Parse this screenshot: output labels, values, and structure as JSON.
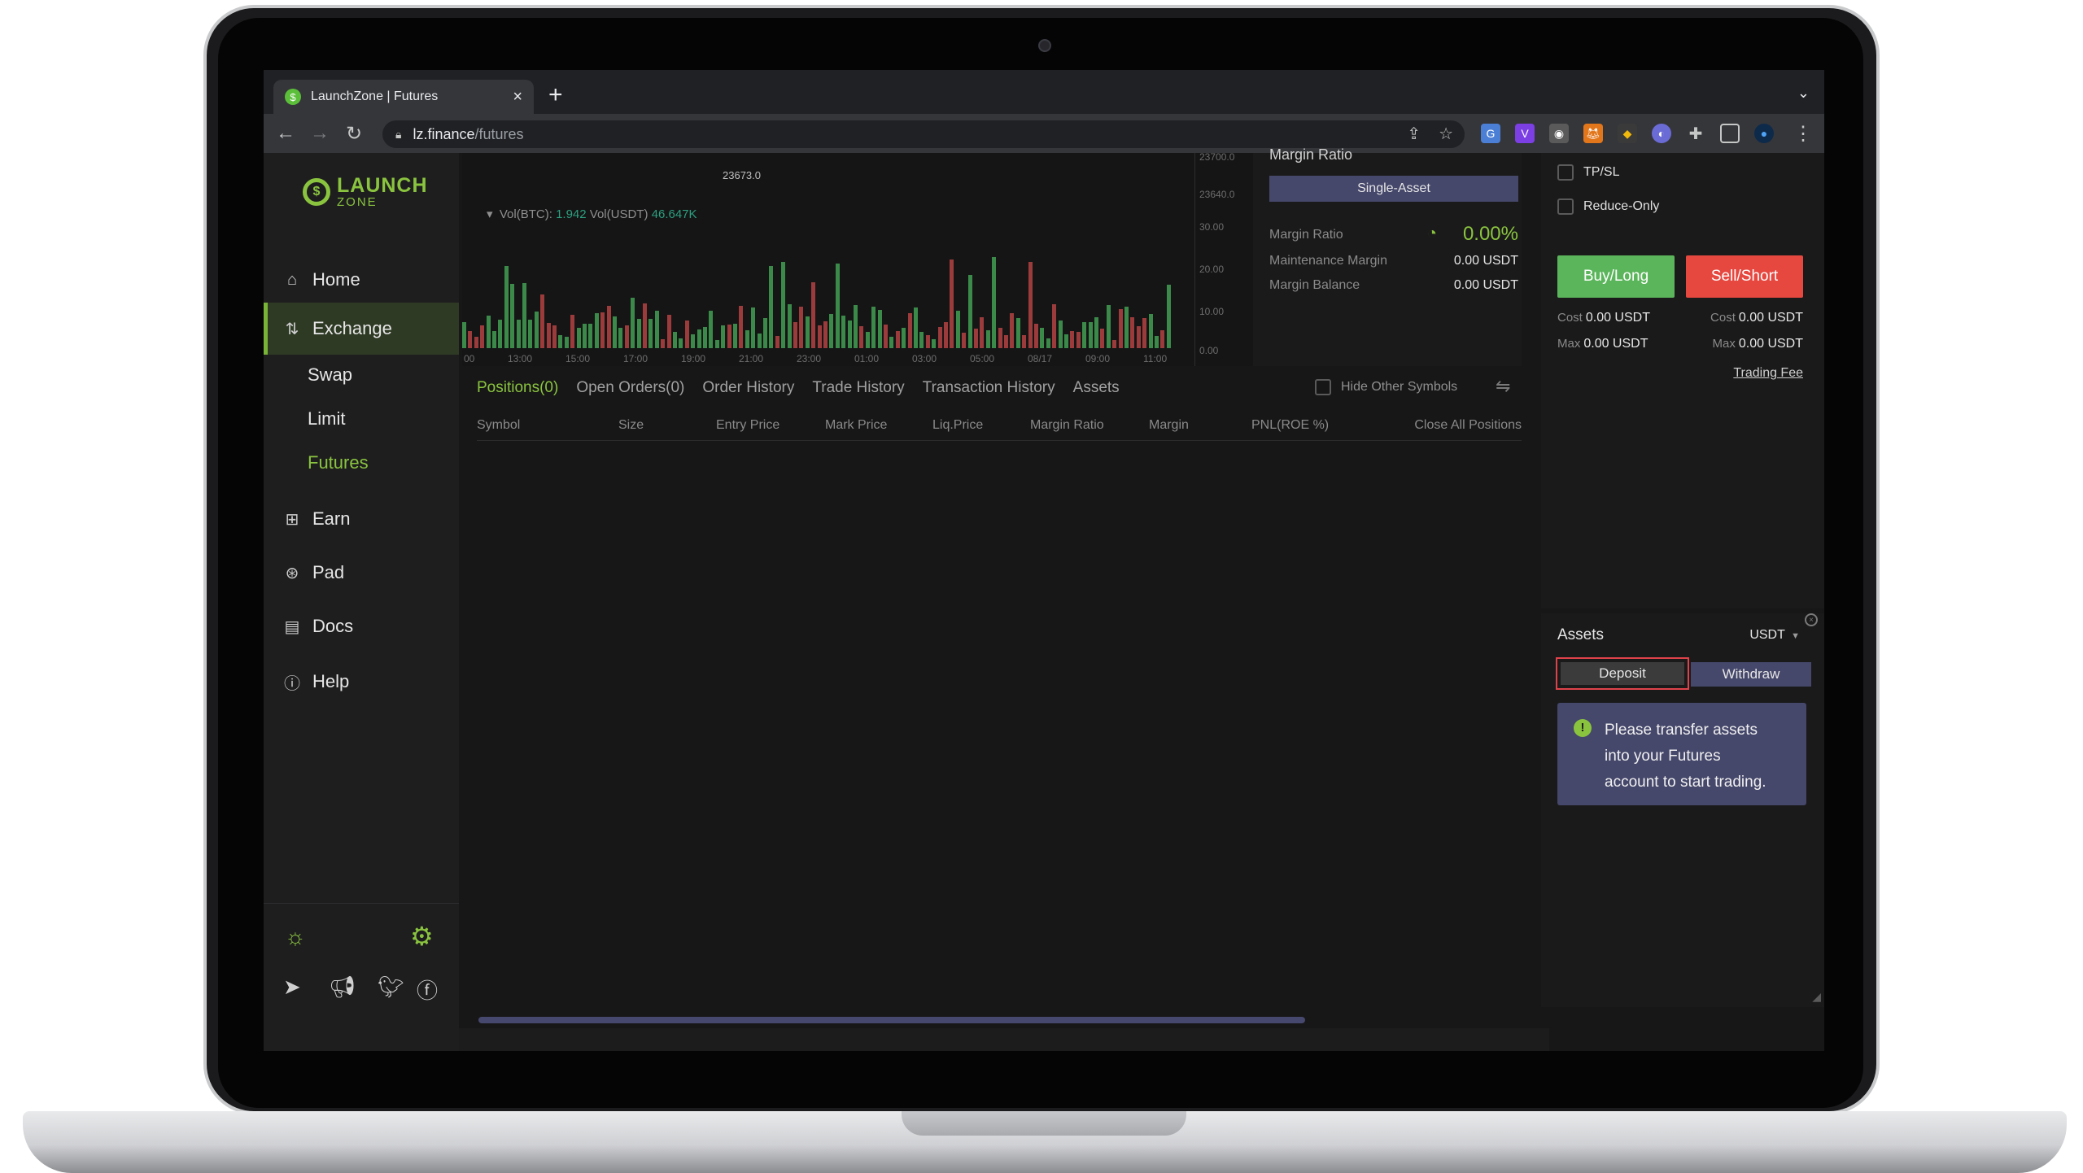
{
  "browser": {
    "tab_title": "LaunchZone | Futures",
    "tab_close": "×",
    "new_tab": "+",
    "url_host": "lz.finance",
    "url_path": "/futures"
  },
  "sidebar": {
    "logo_big": "LAUNCH",
    "logo_small": "ZONE",
    "items": [
      {
        "label": "Home",
        "icon": "home-icon"
      },
      {
        "label": "Exchange",
        "icon": "exchange-icon"
      },
      {
        "label": "Earn",
        "icon": "earn-icon"
      },
      {
        "label": "Pad",
        "icon": "pad-icon"
      },
      {
        "label": "Docs",
        "icon": "docs-icon"
      },
      {
        "label": "Help",
        "icon": "help-icon"
      }
    ],
    "sub_items": [
      "Swap",
      "Limit",
      "Futures"
    ]
  },
  "chart": {
    "price_tag": "23673.0",
    "vol_btc_label": "Vol(BTC):",
    "vol_btc_value": "1.942",
    "vol_usdt_label": "Vol(USDT)",
    "vol_usdt_value": "46.647K",
    "y_ticks": [
      "23700.0",
      "23640.0",
      "30.00",
      "20.00",
      "10.00",
      "0.00"
    ],
    "x_ticks": [
      "00",
      "13:00",
      "15:00",
      "17:00",
      "19:00",
      "21:00",
      "23:00",
      "01:00",
      "03:00",
      "05:00",
      "08/17",
      "09:00",
      "11:00"
    ]
  },
  "margin": {
    "title": "Margin Ratio",
    "mode": "Single-Asset",
    "ratio_label": "Margin Ratio",
    "ratio_value": "0.00%",
    "maintenance_label": "Maintenance Margin",
    "maintenance_value": "0.00 USDT",
    "balance_label": "Margin Balance",
    "balance_value": "0.00 USDT"
  },
  "positions": {
    "tabs": [
      "Positions(0)",
      "Open Orders(0)",
      "Order History",
      "Trade History",
      "Transaction History",
      "Assets"
    ],
    "hide_other": "Hide Other Symbols",
    "columns": [
      "Symbol",
      "Size",
      "Entry Price",
      "Mark Price",
      "Liq.Price",
      "Margin Ratio",
      "Margin",
      "PNL(ROE %)",
      "Close All Positions"
    ]
  },
  "order": {
    "tpsl": "TP/SL",
    "reduce_only": "Reduce-Only",
    "buy_label": "Buy/Long",
    "sell_label": "Sell/Short",
    "cost_key": "Cost",
    "max_key": "Max",
    "buy_cost": "0.00 USDT",
    "buy_max": "0.00 USDT",
    "sell_cost": "0.00 USDT",
    "sell_max": "0.00 USDT",
    "trading_fee": "Trading Fee"
  },
  "assets": {
    "title": "Assets",
    "currency": "USDT",
    "deposit": "Deposit",
    "withdraw": "Withdraw",
    "notice_line1": "Please transfer assets",
    "notice_line2": "into your Futures",
    "notice_line3": "account to start trading."
  },
  "colors": {
    "accent": "#8ac43f",
    "buy": "#5bb55b",
    "sell": "#e6473f",
    "panel_purple": "#45476b"
  }
}
